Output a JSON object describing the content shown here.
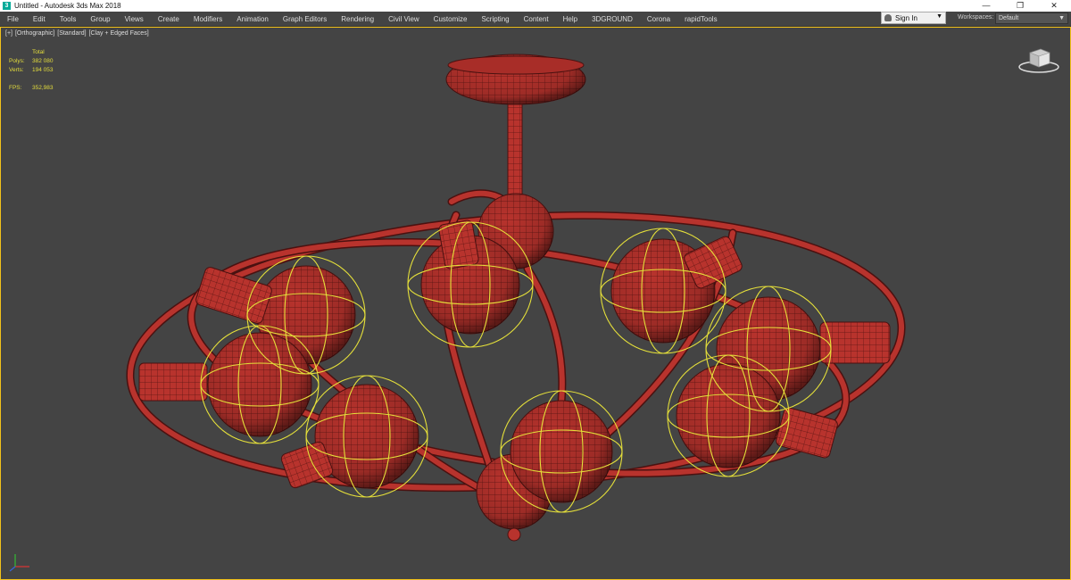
{
  "titlebar": {
    "title": "Untitled - Autodesk 3ds Max 2018",
    "app_icon_letter": "3",
    "minimize": "—",
    "restore": "❐",
    "close": "✕"
  },
  "menu": {
    "items": [
      "File",
      "Edit",
      "Tools",
      "Group",
      "Views",
      "Create",
      "Modifiers",
      "Animation",
      "Graph Editors",
      "Rendering",
      "Civil View",
      "Customize",
      "Scripting",
      "Content",
      "Help",
      "3DGROUND",
      "Corona",
      "rapidTools"
    ]
  },
  "account": {
    "signin_label": "Sign In",
    "arrow": "▼"
  },
  "workspace": {
    "label": "Workspaces:",
    "value": "Default",
    "arrow": "▼"
  },
  "viewport": {
    "label_plus": "[+]",
    "label_view": "[Orthographic]",
    "label_shading": "[Standard]",
    "label_mode": "[Clay + Edged Faces]",
    "stats": {
      "header": "Total",
      "polys_label": "Polys:",
      "polys_value": "382 080",
      "verts_label": "Verts:",
      "verts_value": "194 053",
      "fps_label": "FPS:",
      "fps_value": "352,983"
    },
    "model_color": "#b8332d",
    "selection_color": "#e5e03a",
    "border_color": "#f2c21a",
    "viewcube_icon": "viewcube-icon",
    "axis_icon": "axis-tripod-icon"
  }
}
